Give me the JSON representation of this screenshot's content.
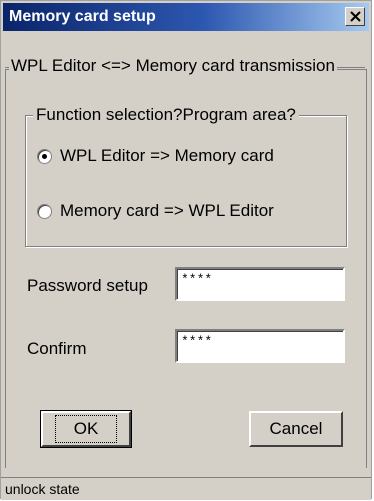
{
  "window": {
    "title": "Memory card setup",
    "close_symbol": "×"
  },
  "transmission_group": {
    "legend": "WPL Editor <=> Memory card transmission"
  },
  "function_group": {
    "legend": "Function selection?Program area?",
    "options": [
      {
        "label": "WPL Editor => Memory card",
        "checked": true
      },
      {
        "label": "Memory card => WPL Editor",
        "checked": false
      }
    ]
  },
  "password": {
    "label": "Password setup",
    "value": "****"
  },
  "confirm": {
    "label": "Confirm",
    "value": "****"
  },
  "buttons": {
    "ok": "OK",
    "cancel": "Cancel"
  },
  "status": {
    "text": "unlock state"
  },
  "colors": {
    "title_gradient_start": "#0a246a",
    "title_gradient_end": "#a6caf0",
    "dialog_bg": "#d4d0c8"
  }
}
